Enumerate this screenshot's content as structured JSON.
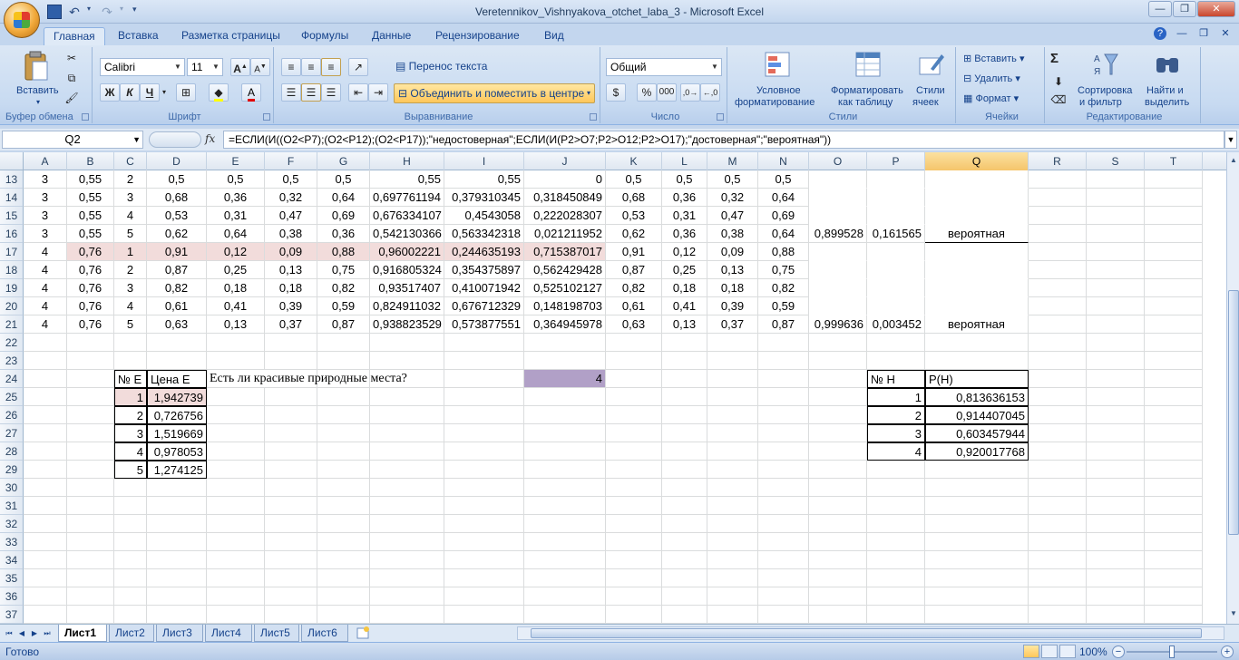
{
  "window": {
    "title": "Veretennikov_Vishnyakova_otchet_laba_3 - Microsoft Excel"
  },
  "ribbon_tabs": [
    "Главная",
    "Вставка",
    "Разметка страницы",
    "Формулы",
    "Данные",
    "Рецензирование",
    "Вид"
  ],
  "ribbon": {
    "clipboard": {
      "paste": "Вставить",
      "label": "Буфер обмена"
    },
    "font": {
      "name": "Calibri",
      "size": "11",
      "label": "Шрифт",
      "bold": "Ж",
      "italic": "К",
      "underline": "Ч"
    },
    "alignment": {
      "wrap": "Перенос текста",
      "merge": "Объединить и поместить в центре",
      "label": "Выравнивание"
    },
    "number": {
      "format": "Общий",
      "label": "Число",
      "currency": "$",
      "percent": "%",
      "thousands": "000"
    },
    "styles": {
      "cond": "Условное",
      "cond2": "форматирование",
      "table": "Форматировать",
      "table2": "как таблицу",
      "cell": "Стили",
      "cell2": "ячеек",
      "label": "Стили"
    },
    "cells": {
      "insert": "Вставить",
      "delete": "Удалить",
      "format": "Формат",
      "label": "Ячейки"
    },
    "editing": {
      "sigma": "Σ",
      "sort": "Сортировка",
      "sort2": "и фильтр",
      "find": "Найти и",
      "find2": "выделить",
      "label": "Редактирование"
    }
  },
  "formula_bar": {
    "name_box": "Q2",
    "fx": "fx",
    "formula": "=ЕСЛИ(И((O2<P7);(O2<P12);(O2<P17));\"недостоверная\";ЕСЛИ(И(P2>O7;P2>O12;P2>O17);\"достоверная\";\"вероятная\"))"
  },
  "columns": [
    "A",
    "B",
    "C",
    "D",
    "E",
    "F",
    "G",
    "H",
    "I",
    "J",
    "K",
    "L",
    "M",
    "N",
    "O",
    "P",
    "Q",
    "R",
    "S",
    "T"
  ],
  "selected_column": "Q",
  "rows": [
    {
      "n": "13",
      "cells": {
        "A": "3",
        "B": "0,55",
        "C": "2",
        "D": "0,5",
        "E": "0,5",
        "F": "0,5",
        "G": "0,5",
        "H": "0,55",
        "I": "0,55",
        "J": "0",
        "K": "0,5",
        "L": "0,5",
        "M": "0,5",
        "N": "0,5"
      }
    },
    {
      "n": "14",
      "cells": {
        "A": "3",
        "B": "0,55",
        "C": "3",
        "D": "0,68",
        "E": "0,36",
        "F": "0,32",
        "G": "0,64",
        "H": "0,697761194",
        "I": "0,379310345",
        "J": "0,318450849",
        "K": "0,68",
        "L": "0,36",
        "M": "0,32",
        "N": "0,64"
      }
    },
    {
      "n": "15",
      "cells": {
        "A": "3",
        "B": "0,55",
        "C": "4",
        "D": "0,53",
        "E": "0,31",
        "F": "0,47",
        "G": "0,69",
        "H": "0,676334107",
        "I": "0,4543058",
        "J": "0,222028307",
        "K": "0,53",
        "L": "0,31",
        "M": "0,47",
        "N": "0,69"
      }
    },
    {
      "n": "16",
      "cells": {
        "A": "3",
        "B": "0,55",
        "C": "5",
        "D": "0,62",
        "E": "0,64",
        "F": "0,38",
        "G": "0,36",
        "H": "0,542130366",
        "I": "0,563342318",
        "J": "0,021211952",
        "K": "0,62",
        "L": "0,36",
        "M": "0,38",
        "N": "0,64",
        "O": "0,899528",
        "P": "0,161565",
        "Q": "вероятная"
      }
    },
    {
      "n": "17",
      "cells": {
        "A": "4",
        "B": "0,76",
        "C": "1",
        "D": "0,91",
        "E": "0,12",
        "F": "0,09",
        "G": "0,88",
        "H": "0,96002221",
        "I": "0,244635193",
        "J": "0,715387017",
        "K": "0,91",
        "L": "0,12",
        "M": "0,09",
        "N": "0,88"
      }
    },
    {
      "n": "18",
      "cells": {
        "A": "4",
        "B": "0,76",
        "C": "2",
        "D": "0,87",
        "E": "0,25",
        "F": "0,13",
        "G": "0,75",
        "H": "0,916805324",
        "I": "0,354375897",
        "J": "0,562429428",
        "K": "0,87",
        "L": "0,25",
        "M": "0,13",
        "N": "0,75"
      }
    },
    {
      "n": "19",
      "cells": {
        "A": "4",
        "B": "0,76",
        "C": "3",
        "D": "0,82",
        "E": "0,18",
        "F": "0,18",
        "G": "0,82",
        "H": "0,93517407",
        "I": "0,410071942",
        "J": "0,525102127",
        "K": "0,82",
        "L": "0,18",
        "M": "0,18",
        "N": "0,82"
      }
    },
    {
      "n": "20",
      "cells": {
        "A": "4",
        "B": "0,76",
        "C": "4",
        "D": "0,61",
        "E": "0,41",
        "F": "0,39",
        "G": "0,59",
        "H": "0,824911032",
        "I": "0,676712329",
        "J": "0,148198703",
        "K": "0,61",
        "L": "0,41",
        "M": "0,39",
        "N": "0,59"
      }
    },
    {
      "n": "21",
      "cells": {
        "A": "4",
        "B": "0,76",
        "C": "5",
        "D": "0,63",
        "E": "0,13",
        "F": "0,37",
        "G": "0,87",
        "H": "0,938823529",
        "I": "0,573877551",
        "J": "0,364945978",
        "K": "0,63",
        "L": "0,13",
        "M": "0,37",
        "N": "0,87",
        "O": "0,999636",
        "P": "0,003452",
        "Q": "вероятная"
      }
    },
    {
      "n": "22",
      "cells": {}
    },
    {
      "n": "23",
      "cells": {}
    },
    {
      "n": "24",
      "cells": {
        "C": "№ E",
        "D": "Цена E",
        "E": "Есть ли красивые природные места?",
        "J": "4",
        "P": "№ H",
        "Q": "P(H)"
      }
    },
    {
      "n": "25",
      "cells": {
        "C": "1",
        "D": "1,942739",
        "P": "1",
        "Q": "0,813636153"
      }
    },
    {
      "n": "26",
      "cells": {
        "C": "2",
        "D": "0,726756",
        "P": "2",
        "Q": "0,914407045"
      }
    },
    {
      "n": "27",
      "cells": {
        "C": "3",
        "D": "1,519669",
        "P": "3",
        "Q": "0,603457944"
      }
    },
    {
      "n": "28",
      "cells": {
        "C": "4",
        "D": "0,978053",
        "P": "4",
        "Q": "0,920017768"
      }
    },
    {
      "n": "29",
      "cells": {
        "C": "5",
        "D": "1,274125"
      }
    },
    {
      "n": "30",
      "cells": {}
    },
    {
      "n": "31",
      "cells": {}
    },
    {
      "n": "32",
      "cells": {}
    },
    {
      "n": "33",
      "cells": {}
    },
    {
      "n": "34",
      "cells": {}
    },
    {
      "n": "35",
      "cells": {}
    },
    {
      "n": "36",
      "cells": {}
    },
    {
      "n": "37",
      "cells": {}
    }
  ],
  "sheets": [
    "Лист1",
    "Лист2",
    "Лист3",
    "Лист4",
    "Лист5",
    "Лист6"
  ],
  "active_sheet": "Лист1",
  "status": {
    "ready": "Готово",
    "zoom": "100%"
  }
}
